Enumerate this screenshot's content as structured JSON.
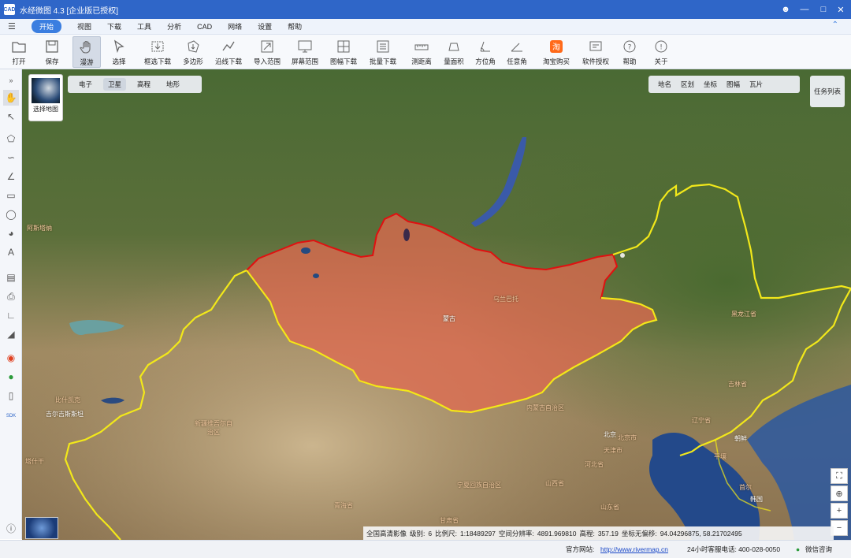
{
  "title": "水经微图 4.3 [企业版已授权]",
  "menu": [
    "开始",
    "视图",
    "下载",
    "工具",
    "分析",
    "CAD",
    "网络",
    "设置",
    "帮助"
  ],
  "toolbar": [
    {
      "label": "打开",
      "icon": "folder-icon"
    },
    {
      "label": "保存",
      "icon": "save-icon"
    },
    {
      "label": "漫游",
      "icon": "hand-icon"
    },
    {
      "label": "选择",
      "icon": "cursor-icon"
    },
    {
      "label": "框选下载",
      "icon": "box-download-icon"
    },
    {
      "label": "多边形",
      "icon": "polygon-download-icon"
    },
    {
      "label": "沿线下载",
      "icon": "line-download-icon"
    },
    {
      "label": "导入范围",
      "icon": "import-range-icon"
    },
    {
      "label": "屏幕范围",
      "icon": "screen-range-icon"
    },
    {
      "label": "图幅下载",
      "icon": "sheet-download-icon"
    },
    {
      "label": "批量下载",
      "icon": "batch-download-icon"
    },
    {
      "label": "测距离",
      "icon": "ruler-icon"
    },
    {
      "label": "量面积",
      "icon": "area-icon"
    },
    {
      "label": "方位角",
      "icon": "azimuth-icon"
    },
    {
      "label": "任意角",
      "icon": "angle-icon"
    },
    {
      "label": "淘宝购买",
      "icon": "taobao-icon"
    },
    {
      "label": "软件授权",
      "icon": "license-icon"
    },
    {
      "label": "帮助",
      "icon": "help-icon"
    },
    {
      "label": "关于",
      "icon": "info-icon"
    }
  ],
  "map_layer_label": "选择地图",
  "map_types": [
    "电子",
    "卫星",
    "高程",
    "地形"
  ],
  "overlays": [
    "地名",
    "区划",
    "坐标",
    "图幅",
    "瓦片"
  ],
  "task_list": "任务列表",
  "map_labels": {
    "mongolia": "蒙古",
    "ulaanbaatar": "乌兰巴托",
    "heilongjiang": "黑龙江省",
    "jilin": "吉林省",
    "liaoning": "辽宁省",
    "inner_mongolia": "内蒙古自治区",
    "xinjiang": "新疆维吾尔自治区",
    "beijing": "北京",
    "beijing_city": "北京市",
    "tianjin": "天津市",
    "hebei": "河北省",
    "shanxi": "山西省",
    "shandong": "山东省",
    "ningxia": "宁夏回族自治区",
    "gansu": "甘肃省",
    "qinghai": "青海省",
    "north_korea": "朝鲜",
    "south_korea": "韩国",
    "pyongyang": "平壤",
    "seoul": "首尔",
    "kyrgyzstan": "吉尔吉斯斯坦",
    "kazakh_city": "比什凯克",
    "astana": "阿斯塔纳",
    "tashkent": "塔什干"
  },
  "info": {
    "source": "全国高清影像",
    "level_label": "级别:",
    "level": "6",
    "scale_label": "比例尺:",
    "scale": "1:18489297",
    "resolution_label": "空间分辨率:",
    "resolution": "4891.969810",
    "elevation_label": "高程:",
    "elevation": "357.19",
    "offset_label": "坐标无偏移:",
    "coords": "94.04296875, 58.21702495"
  },
  "status": {
    "site_label": "官方网站:",
    "site_url": "http://www.rivermap.cn",
    "phone": "24小时客服电话: 400-028-0050",
    "wechat": "微信咨询"
  },
  "colors": {
    "title_bar": "#2f66c8",
    "mongolia_fill": "#e06a50",
    "mongolia_border": "#e01010",
    "china_border": "#f2e81a"
  }
}
